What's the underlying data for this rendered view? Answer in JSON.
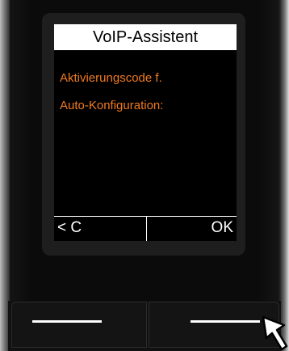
{
  "display": {
    "title": "VoIP-Assistent",
    "line1": "Aktivierungscode f.",
    "line2": "Auto-Konfiguration:",
    "softkey_left": "< C",
    "softkey_right": "OK"
  },
  "colors": {
    "accent_text": "#f07a1f",
    "title_bg": "#ffffff",
    "screen_bg": "#000000"
  },
  "icons": {
    "pointer": "arrow-pointer-icon"
  }
}
